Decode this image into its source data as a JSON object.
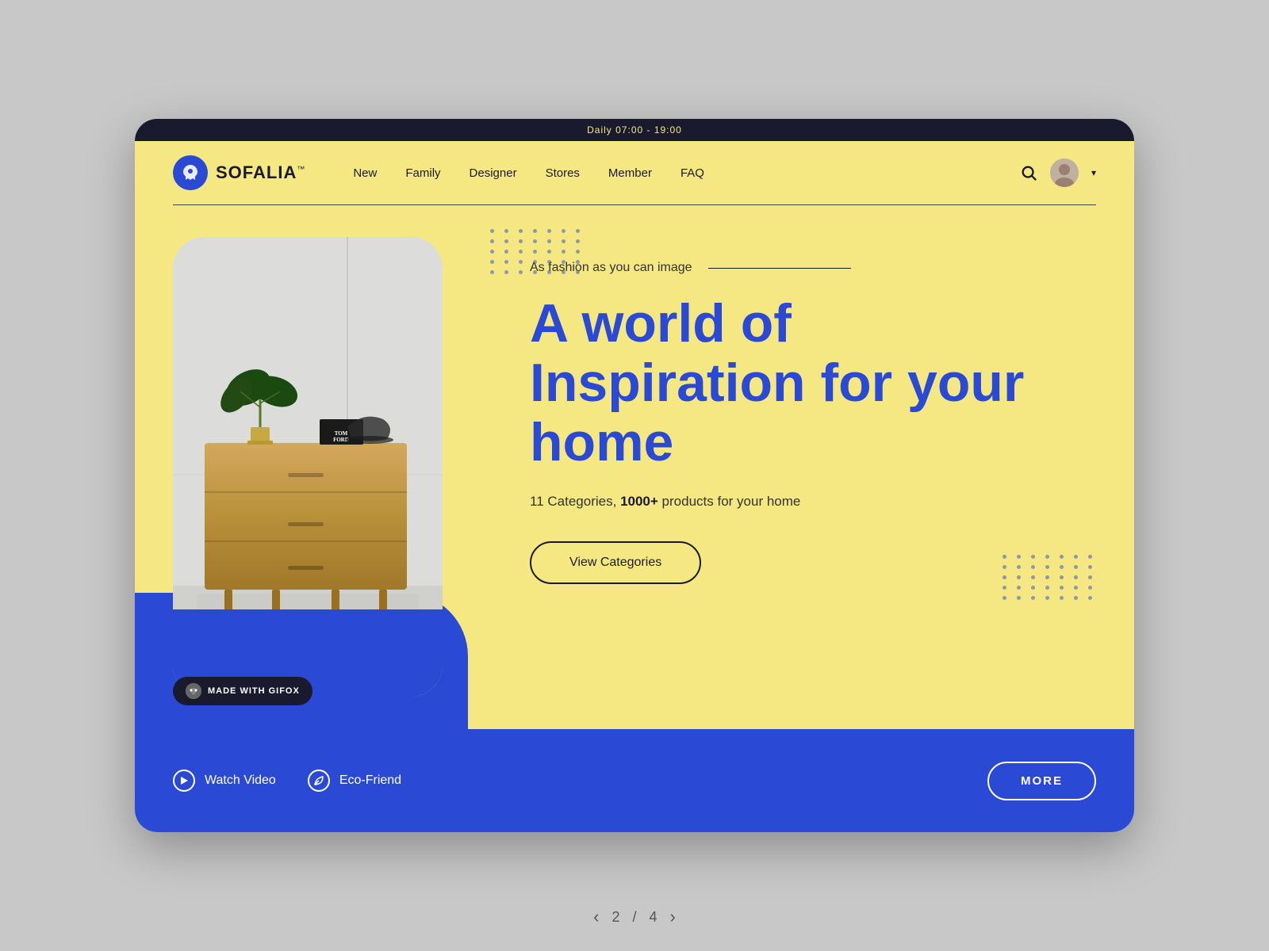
{
  "top_bar": {
    "text": "Daily 07:00 - 19:00"
  },
  "logo": {
    "text": "SOFALIA",
    "tm": "™"
  },
  "nav": {
    "links": [
      {
        "id": "new",
        "label": "New"
      },
      {
        "id": "family",
        "label": "Family"
      },
      {
        "id": "designer",
        "label": "Designer"
      },
      {
        "id": "stores",
        "label": "Stores"
      },
      {
        "id": "member",
        "label": "Member"
      },
      {
        "id": "faq",
        "label": "FAQ"
      }
    ]
  },
  "hero": {
    "tagline": "As fashion as you can image",
    "title_line1": "A world of",
    "title_line2": "Inspiration for your",
    "title_line3": "home",
    "subtitle_count": "11",
    "subtitle_mid": "Categories,",
    "subtitle_bold": "1000+",
    "subtitle_end": "products for your home",
    "cta_button": "View Categories"
  },
  "bottom_bar": {
    "watch_label": "Watch Video",
    "eco_label": "Eco-Friend",
    "more_button": "MORE"
  },
  "gifox": {
    "label": "MADE WITH GIFOX"
  },
  "pagination": {
    "prev": "‹",
    "current": "2",
    "separator": "/",
    "total": "4",
    "next": "›"
  },
  "dots": {
    "rows": 5,
    "cols": 7
  }
}
